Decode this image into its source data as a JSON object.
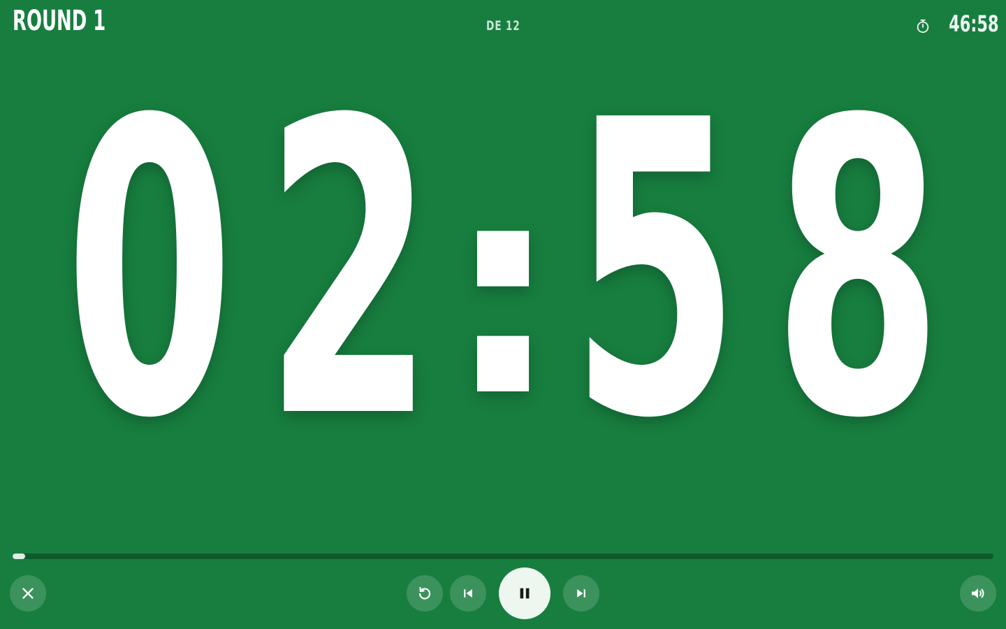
{
  "header": {
    "round_label": "ROUND 1",
    "round_total": "DE 12",
    "total_remaining": "46:58",
    "total_icon": "stopwatch-icon"
  },
  "timer": {
    "display": "02:58",
    "digits": [
      "0",
      "2",
      ":",
      "5",
      "8"
    ]
  },
  "progress": {
    "fraction": 0.012
  },
  "controls": {
    "close_icon": "close-icon",
    "reset_icon": "restart-icon",
    "previous_icon": "skip-previous-icon",
    "pause_icon": "pause-icon",
    "next_icon": "skip-next-icon",
    "volume_icon": "volume-icon"
  },
  "colors": {
    "background": "#177e3f",
    "progress_track": "#0f5a2b",
    "progress_fill": "#dfeee4",
    "main_button": "#eef6f0",
    "text": "#ffffff"
  }
}
